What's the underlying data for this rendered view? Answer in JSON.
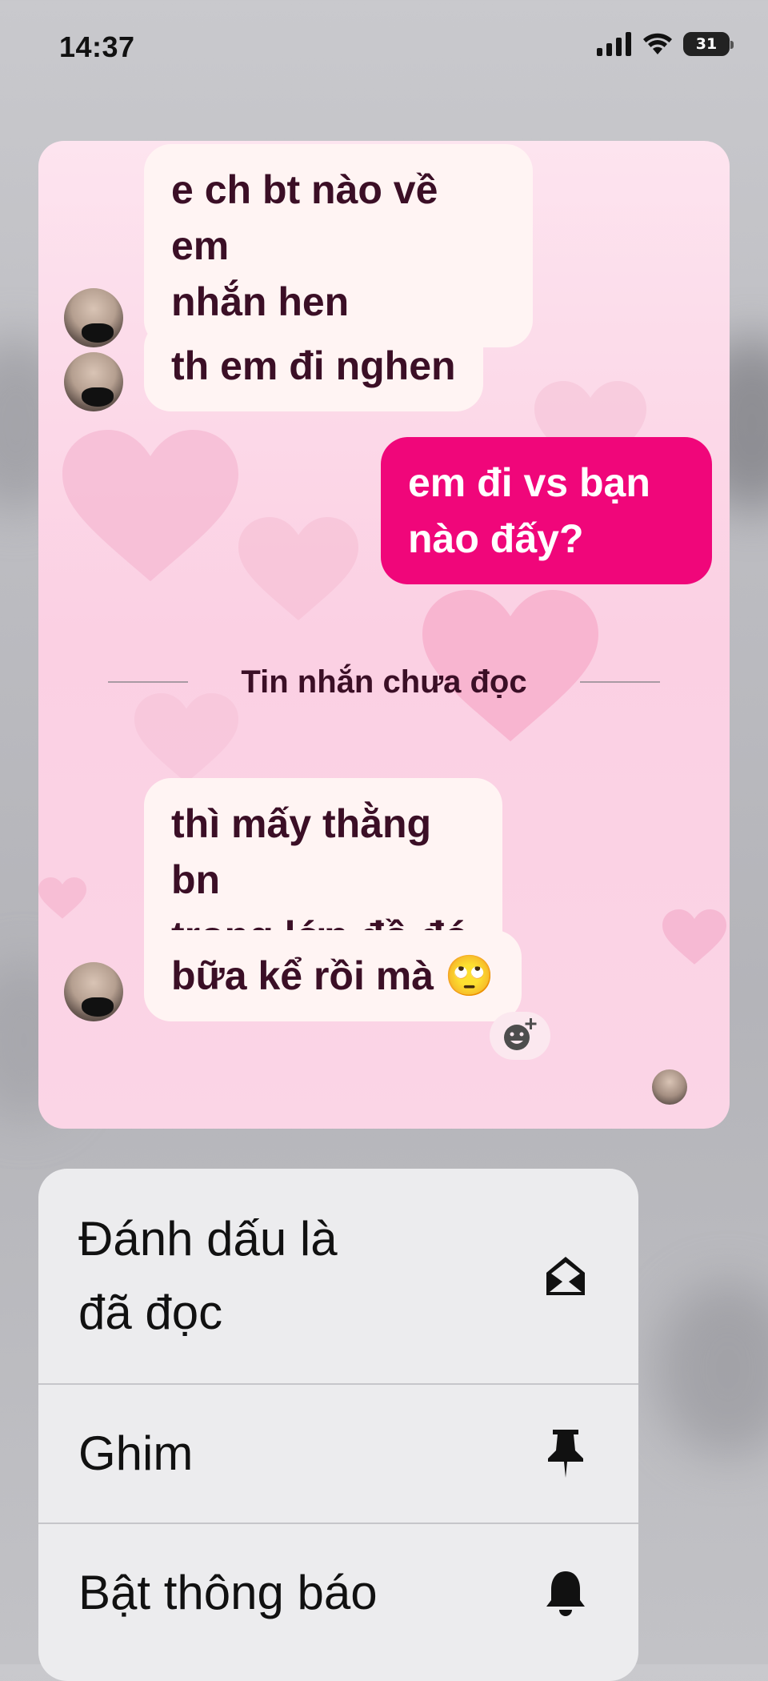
{
  "status_bar": {
    "time": "14:37",
    "battery": "31",
    "icons": [
      "signal-icon",
      "wifi-icon",
      "battery-icon"
    ]
  },
  "chat": {
    "messages": [
      {
        "side": "in",
        "text_lines": [
          "e ch bt nào về em",
          "nhắn hen"
        ]
      },
      {
        "side": "in",
        "text_lines": [
          "th em đi nghen"
        ]
      },
      {
        "side": "out",
        "text_lines": [
          "em đi vs bạn",
          "nào đấy?"
        ]
      },
      {
        "side": "in",
        "text_lines": [
          "thì mấy thằng bn",
          "trong lớp đồ đó"
        ]
      },
      {
        "side": "in",
        "text": "bữa kể rồi mà",
        "emoji": "🙄"
      }
    ],
    "unread_divider": "Tin nhắn chưa đọc",
    "colors": {
      "incoming_bubble": "#fff4f3",
      "outgoing_bubble": "#f0067a",
      "text": "#3b0f26"
    }
  },
  "menu": {
    "items": [
      {
        "label_lines": [
          "Đánh dấu là",
          "đã đọc"
        ],
        "icon": "envelope-open-icon"
      },
      {
        "label": "Ghim",
        "icon": "pin-icon"
      },
      {
        "label": "Bật thông báo",
        "icon": "bell-icon"
      }
    ]
  }
}
